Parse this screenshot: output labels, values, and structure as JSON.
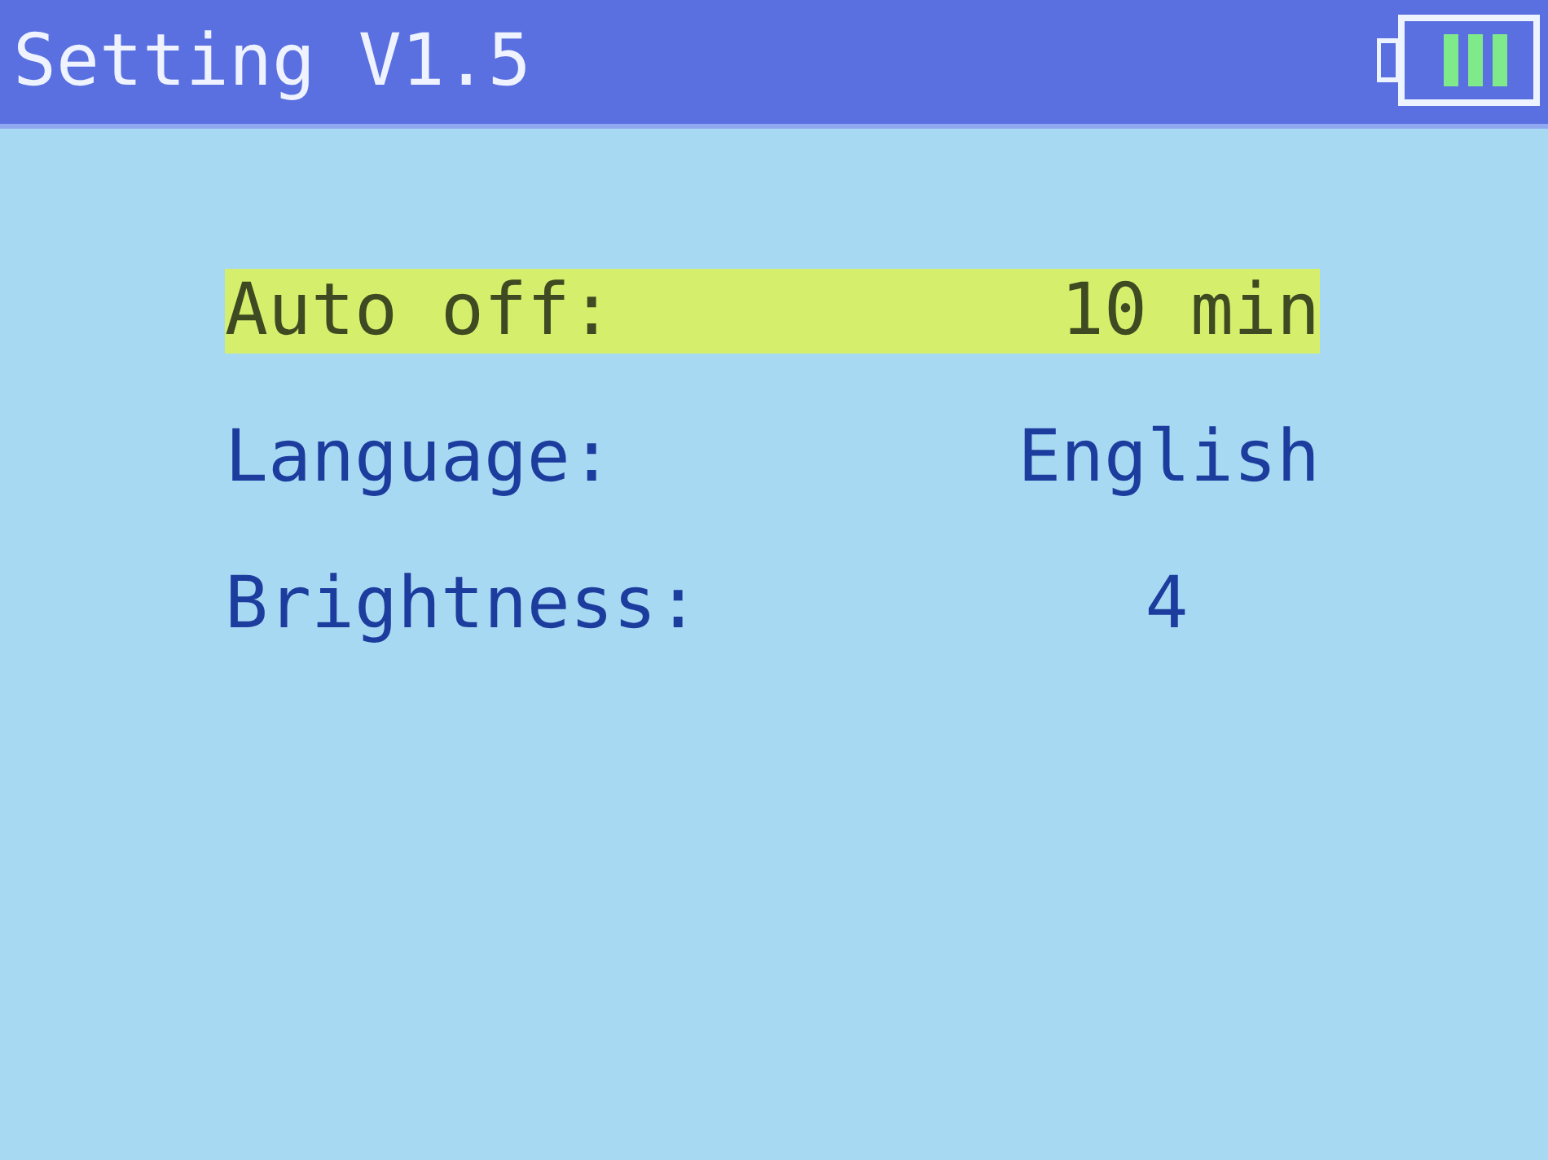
{
  "title_bar": {
    "title": "Setting V1.5"
  },
  "settings": [
    {
      "label": "Auto off:",
      "value": "10 min",
      "selected": true
    },
    {
      "label": "Language:",
      "value": "English",
      "selected": false
    },
    {
      "label": "Brightness:",
      "value": "4",
      "selected": false
    }
  ]
}
